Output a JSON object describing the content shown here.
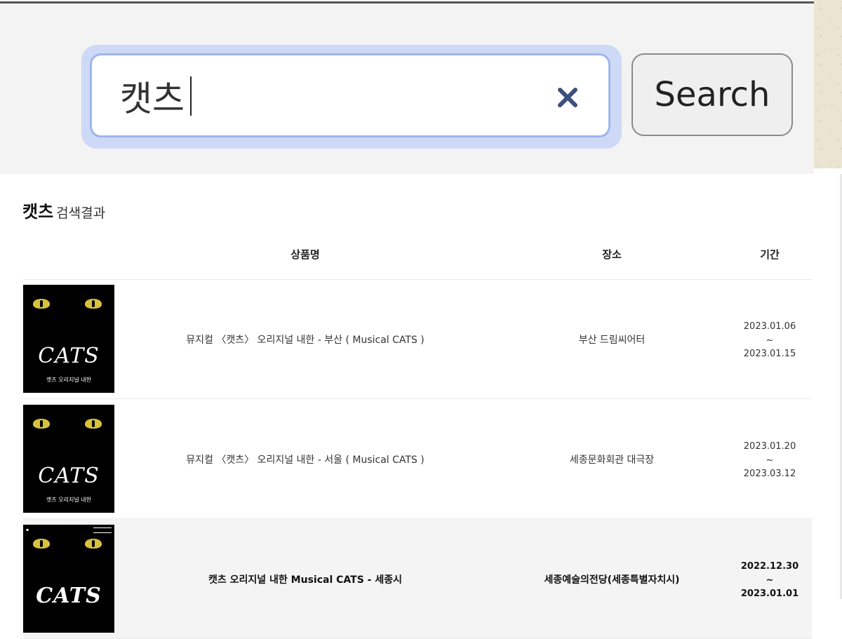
{
  "search": {
    "value": "캣츠",
    "button_label": "Search"
  },
  "results": {
    "query": "캣츠",
    "title_suffix": "검색결과",
    "columns": [
      "상품명",
      "장소",
      "기간"
    ],
    "rows": [
      {
        "poster_title": "CATS",
        "poster_sub": "캣츠 오리지널 내한",
        "name": "뮤지컬 〈캣츠〉 오리지널 내한 - 부산 ( Musical CATS )",
        "venue": "부산 드림씨어터",
        "start": "2023.01.06",
        "sep": "~",
        "end": "2023.01.15"
      },
      {
        "poster_title": "CATS",
        "poster_sub": "캣츠 오리지널 내한",
        "name": "뮤지컬 〈캣츠〉 오리지널 내한 - 서울 ( Musical CATS )",
        "venue": "세종문화회관 대극장",
        "start": "2023.01.20",
        "sep": "~",
        "end": "2023.03.12"
      },
      {
        "poster_title": "CATS",
        "poster_sub": "",
        "name": "캣츠 오리지널 내한 Musical CATS - 세종시",
        "venue": "세종예술의전당(세종특별자치시)",
        "start": "2022.12.30",
        "sep": "~",
        "end": "2023.01.01"
      }
    ]
  },
  "colors": {
    "focus_ring": "#cdd9f6",
    "clear_icon": "#3d4f7a",
    "poster_eye": "#d8c23c"
  },
  "icons": {
    "clear": "close-icon"
  }
}
